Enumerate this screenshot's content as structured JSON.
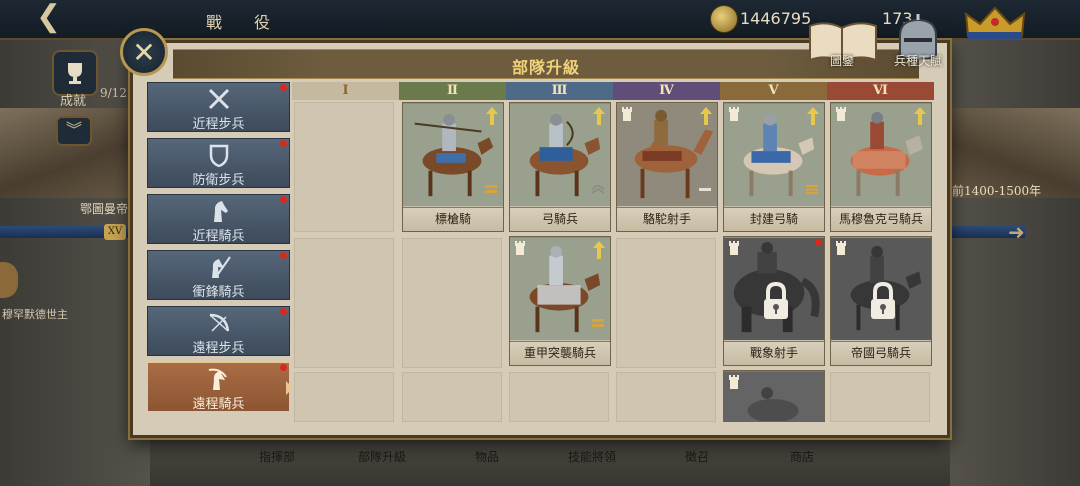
{
  "topbar": {
    "back_glyph": "❮",
    "title": "戰　役",
    "coins": "1446795",
    "gems": "173"
  },
  "left_panel": {
    "achievement_label": "成就",
    "progress": "9/12",
    "era_title": "鄂圖曼帝",
    "era_badge": "XV",
    "ruler": "穆罕默德世主"
  },
  "right_panel": {
    "era_years": "前1400-1500年",
    "arrow": "➜"
  },
  "modal": {
    "title": "部隊升級",
    "close_glyph": "✕",
    "codex_label": "圖鑒",
    "talent_label": "兵種天賦"
  },
  "categories": [
    {
      "label": "近程步兵",
      "icon": "crossed-swords-icon",
      "active": false
    },
    {
      "label": "防衛步兵",
      "icon": "shield-icon",
      "active": false
    },
    {
      "label": "近程騎兵",
      "icon": "horse-head-icon",
      "active": false
    },
    {
      "label": "衝鋒騎兵",
      "icon": "lance-horse-icon",
      "active": false
    },
    {
      "label": "遠程步兵",
      "icon": "bow-icon",
      "active": false
    },
    {
      "label": "遠程騎兵",
      "icon": "horse-archer-icon",
      "active": true
    }
  ],
  "tiers": [
    {
      "label": "Ⅰ",
      "color": "#c5b99f"
    },
    {
      "label": "Ⅱ",
      "color": "#6b7a4a"
    },
    {
      "label": "Ⅲ",
      "color": "#4e6a86"
    },
    {
      "label": "Ⅳ",
      "color": "#5e4e78"
    },
    {
      "label": "Ⅴ",
      "color": "#8a6a3a"
    },
    {
      "label": "Ⅵ",
      "color": "#9a4a34"
    }
  ],
  "units": {
    "r1_t2": {
      "name": "標槍騎"
    },
    "r1_t3": {
      "name": "弓騎兵"
    },
    "r1_t4": {
      "name": "駱駝射手"
    },
    "r1_t5": {
      "name": "封建弓騎"
    },
    "r1_t6": {
      "name": "馬穆魯克弓騎兵"
    },
    "r2_t3": {
      "name": "重甲突襲騎兵"
    },
    "r2_t5": {
      "name": "戰象射手"
    },
    "r2_t6": {
      "name": "帝國弓騎兵"
    }
  },
  "bottom_nav": [
    "指揮部",
    "部隊升級",
    "物品",
    "技能將領",
    "徵召",
    "商店"
  ],
  "colors": {
    "accent_gold": "#f0d27a",
    "category_blue": "#4a5a6c",
    "category_active": "#9a6040",
    "badge_red": "#d32a1c"
  }
}
